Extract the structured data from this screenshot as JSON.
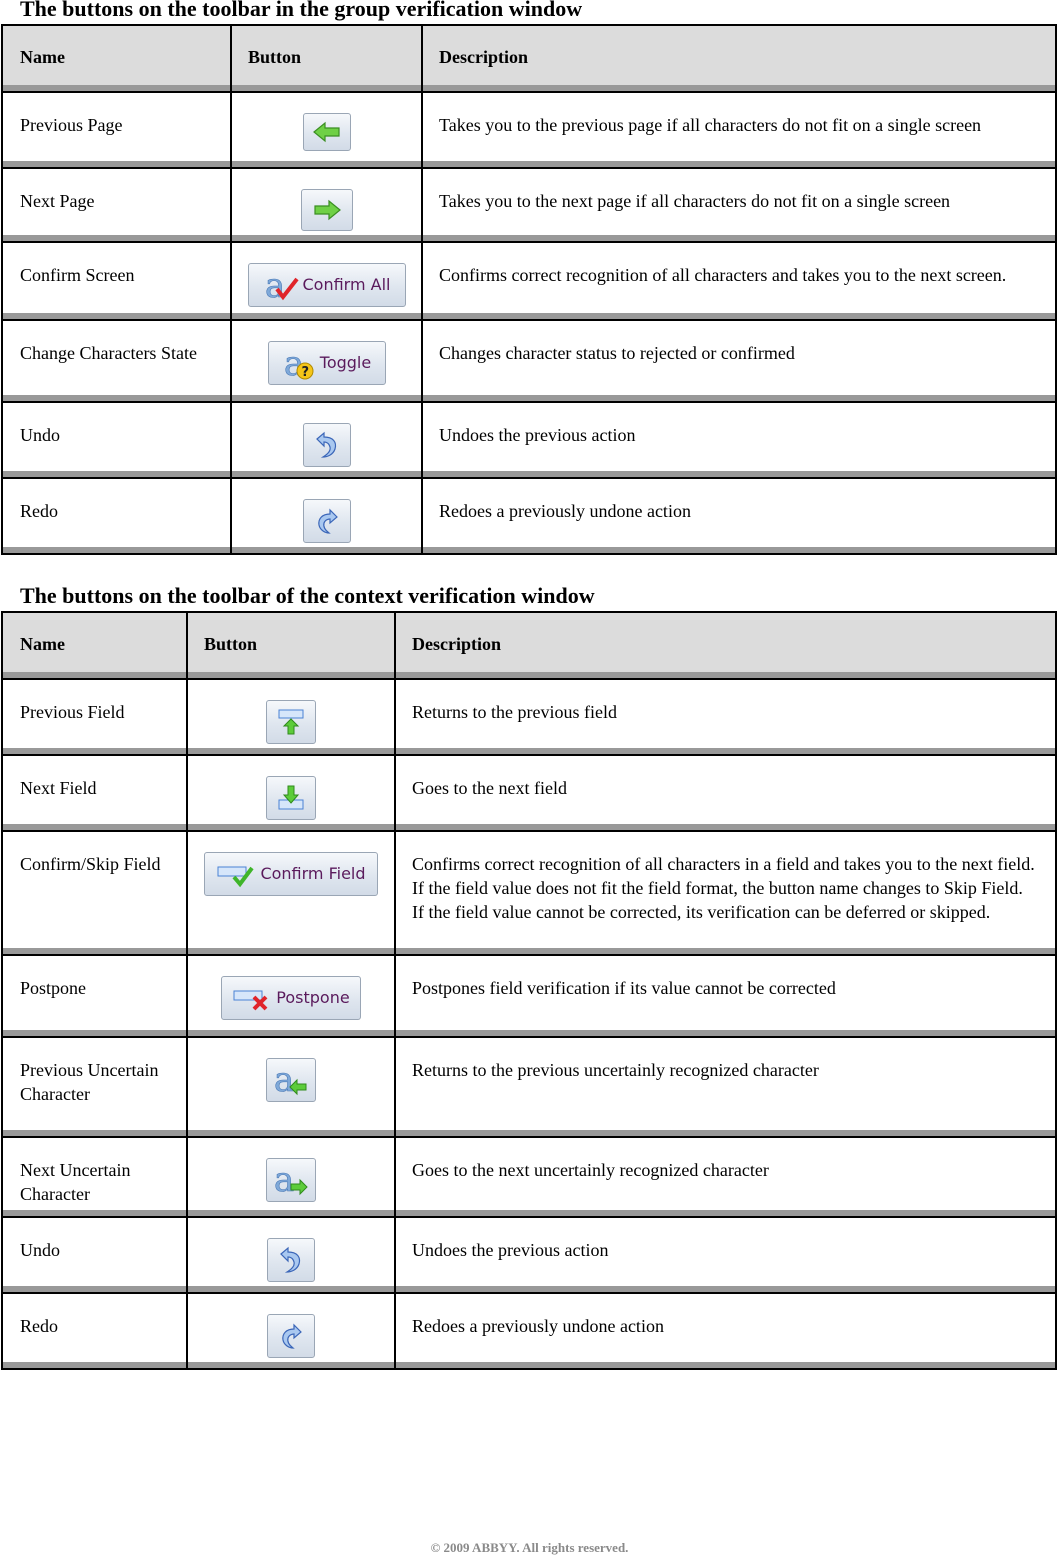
{
  "tables": [
    {
      "title": "The buttons on the toolbar in the group verification window",
      "headers": [
        "Name",
        "Button",
        "Description"
      ],
      "rows": [
        {
          "name": "Previous Page",
          "icon": "arrow-left-green-icon",
          "button_label": "",
          "description": "Takes you to the previous page if all characters do not fit on a single screen"
        },
        {
          "name": "Next Page",
          "icon": "arrow-right-green-icon",
          "button_label": "",
          "description": "Takes you to the next page if all characters do not fit on a single screen"
        },
        {
          "name": "Confirm Screen",
          "icon": "letter-a-check-icon",
          "button_label": "Confirm All",
          "description": "Confirms correct recognition of all characters and takes you to the next screen."
        },
        {
          "name": "Change Characters State",
          "icon": "letter-a-question-icon",
          "button_label": "Toggle",
          "description": "Changes character status to rejected or confirmed"
        },
        {
          "name": "Undo",
          "icon": "undo-icon",
          "button_label": "",
          "description": "Undoes the previous action"
        },
        {
          "name": "Redo",
          "icon": "redo-icon",
          "button_label": "",
          "description": "Redoes a previously undone action"
        }
      ]
    },
    {
      "title": "The buttons on the toolbar of the context verification window",
      "headers": [
        "Name",
        "Button",
        "Description"
      ],
      "rows": [
        {
          "name": "Previous Field",
          "icon": "field-up-arrow-icon",
          "button_label": "",
          "description": "Returns to the previous field"
        },
        {
          "name": "Next Field",
          "icon": "field-down-arrow-icon",
          "button_label": "",
          "description": "Goes to the next field"
        },
        {
          "name": "Confirm/Skip Field",
          "icon": "field-check-icon",
          "button_label": "Confirm Field",
          "description": "Confirms correct recognition of all characters in a field and takes you to the next field. If the field value does not fit the field format, the button name changes to Skip Field. If the field value cannot be corrected, its verification can be deferred or skipped."
        },
        {
          "name": "Postpone",
          "icon": "field-cross-icon",
          "button_label": "Postpone",
          "description": "Postpones field verification if its value cannot be corrected"
        },
        {
          "name": "Previous Uncertain Character",
          "icon": "letter-a-left-arrow-icon",
          "button_label": "",
          "description": "Returns to the previous uncertainly recognized character"
        },
        {
          "name": "Next Uncertain Character",
          "icon": "letter-a-right-arrow-icon",
          "button_label": "",
          "description": "Goes to the next uncertainly recognized character"
        },
        {
          "name": "Undo",
          "icon": "undo-icon",
          "button_label": "",
          "description": "Undoes the previous action"
        },
        {
          "name": "Redo",
          "icon": "redo-icon",
          "button_label": "",
          "description": "Redoes a previously undone action"
        }
      ]
    }
  ],
  "footer": "© 2009 ABBYY. All rights reserved."
}
